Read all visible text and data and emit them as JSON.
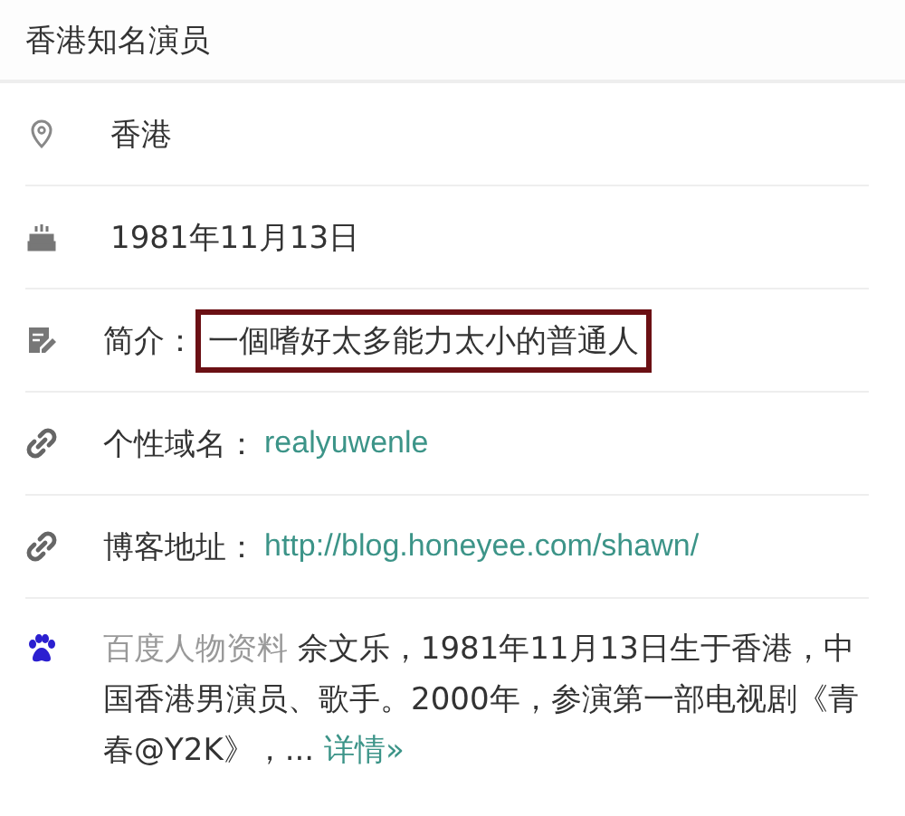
{
  "title": "香港知名演员",
  "rows": [
    {
      "kind": "location",
      "value": "香港"
    },
    {
      "kind": "birthday",
      "value": "1981年11月13日"
    },
    {
      "kind": "intro",
      "label": "简介：",
      "value": "一個嗜好太多能力太小的普通人",
      "highlighted": true
    },
    {
      "kind": "link",
      "label": "个性域名：",
      "value": "realyuwenle"
    },
    {
      "kind": "link",
      "label": "博客地址：",
      "value": "http://blog.honeyee.com/shawn/"
    }
  ],
  "bio": {
    "source": "百度人物资料",
    "text": "佘文乐，1981年11月13日生于香港，中国香港男演员、歌手。2000年，参演第一部电视剧《青春@Y2K》，...",
    "more": "详情»"
  }
}
